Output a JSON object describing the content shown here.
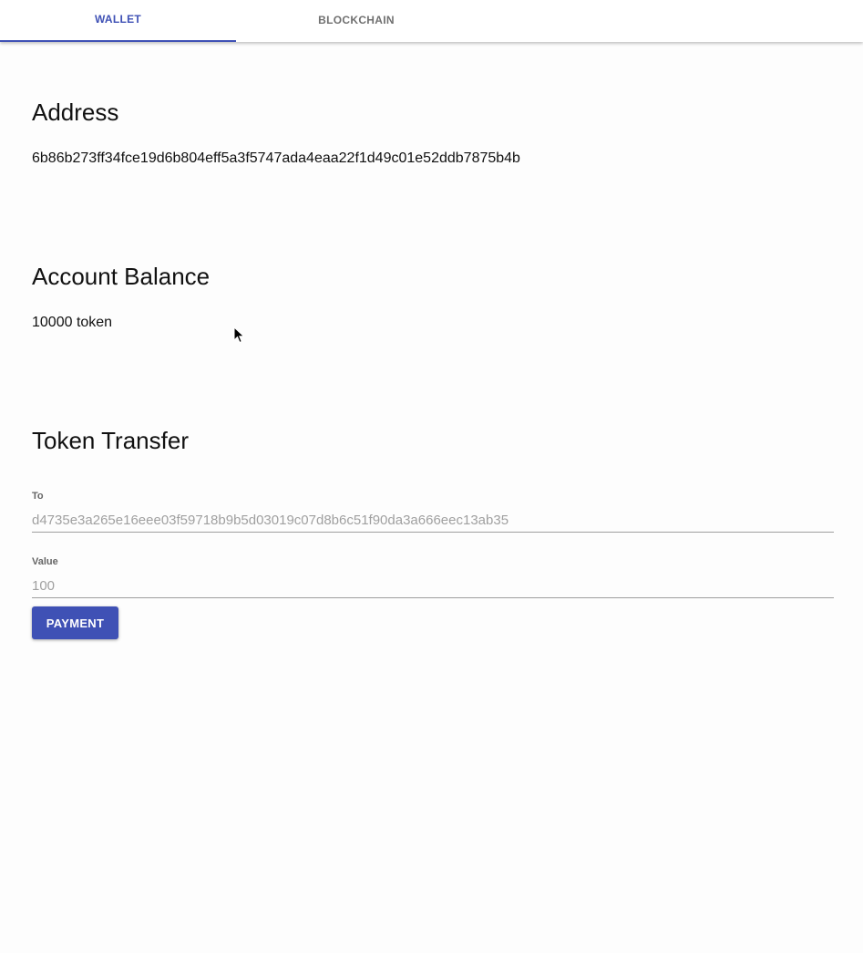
{
  "tabs": [
    {
      "label": "WALLET",
      "active": true
    },
    {
      "label": "BLOCKCHAIN",
      "active": false
    }
  ],
  "address": {
    "heading": "Address",
    "value": "6b86b273ff34fce19d6b804eff5a3f5747ada4eaa22f1d49c01e52ddb7875b4b"
  },
  "balance": {
    "heading": "Account Balance",
    "value": "10000 token"
  },
  "transfer": {
    "heading": "Token Transfer",
    "to_label": "To",
    "to_placeholder": "d4735e3a265e16eee03f59718b9b5d03019c07d8b6c51f90da3a666eec13ab35",
    "value_label": "Value",
    "value_placeholder": "100",
    "button_label": "PAYMENT"
  },
  "colors": {
    "accent": "#3f51b5",
    "background": "#fdfdfd"
  },
  "icons": {
    "cursor": "mouse-pointer-icon"
  }
}
